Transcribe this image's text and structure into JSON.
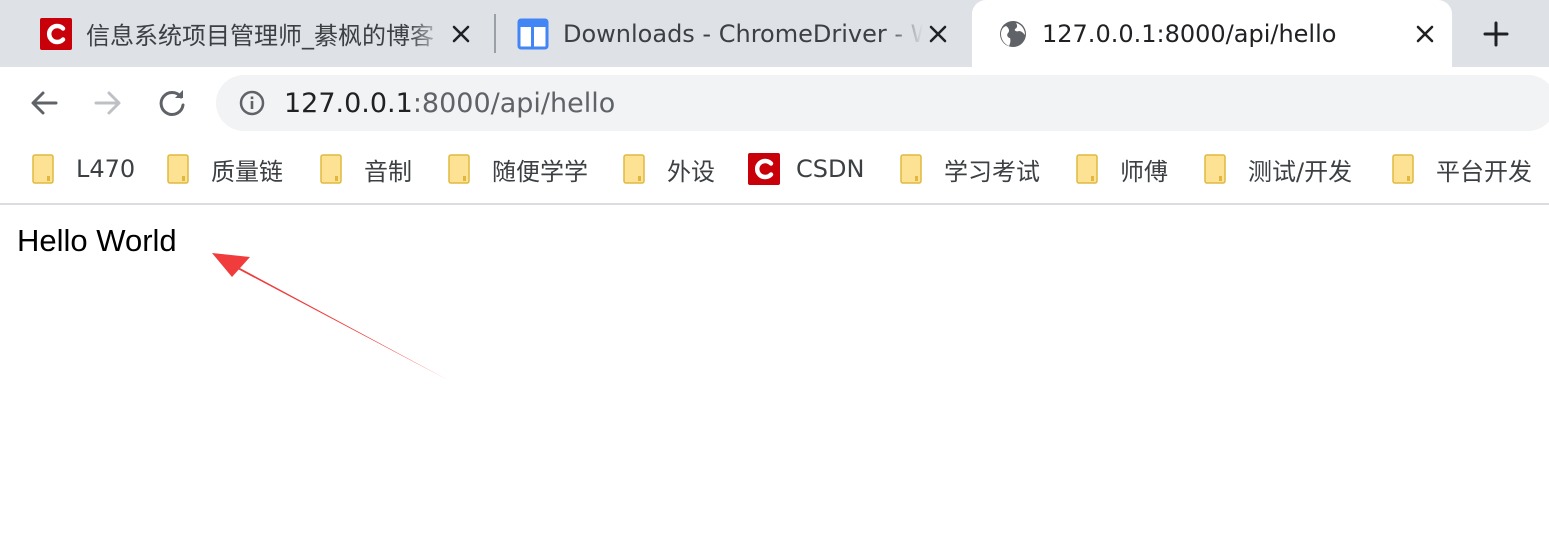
{
  "tabs": [
    {
      "title": "信息系统项目管理师_綦枫的博客",
      "favicon": "csdn-icon",
      "active": false
    },
    {
      "title": "Downloads - ChromeDriver - W",
      "favicon": "page-layout-icon",
      "active": false
    },
    {
      "title": "127.0.0.1:8000/api/hello",
      "favicon": "globe-icon",
      "active": true
    }
  ],
  "toolbar": {
    "url_host": "127.0.0.1",
    "url_rest": ":8000/api/hello"
  },
  "bookmarks": [
    {
      "label": "L470",
      "icon": "folder-icon"
    },
    {
      "label": "质量链",
      "icon": "folder-icon"
    },
    {
      "label": "音制",
      "icon": "folder-icon"
    },
    {
      "label": "随便学学",
      "icon": "folder-icon"
    },
    {
      "label": "外设",
      "icon": "folder-icon"
    },
    {
      "label": "CSDN",
      "icon": "csdn-icon"
    },
    {
      "label": "学习考试",
      "icon": "folder-icon"
    },
    {
      "label": "师傅",
      "icon": "folder-icon"
    },
    {
      "label": "测试/开发",
      "icon": "folder-icon"
    },
    {
      "label": "平台开发",
      "icon": "folder-icon"
    }
  ],
  "page": {
    "body_text": "Hello World"
  },
  "colors": {
    "tabstrip_bg": "#dee1e6",
    "csdn_red": "#c8000a",
    "annotation_arrow": "#f03c3c"
  }
}
